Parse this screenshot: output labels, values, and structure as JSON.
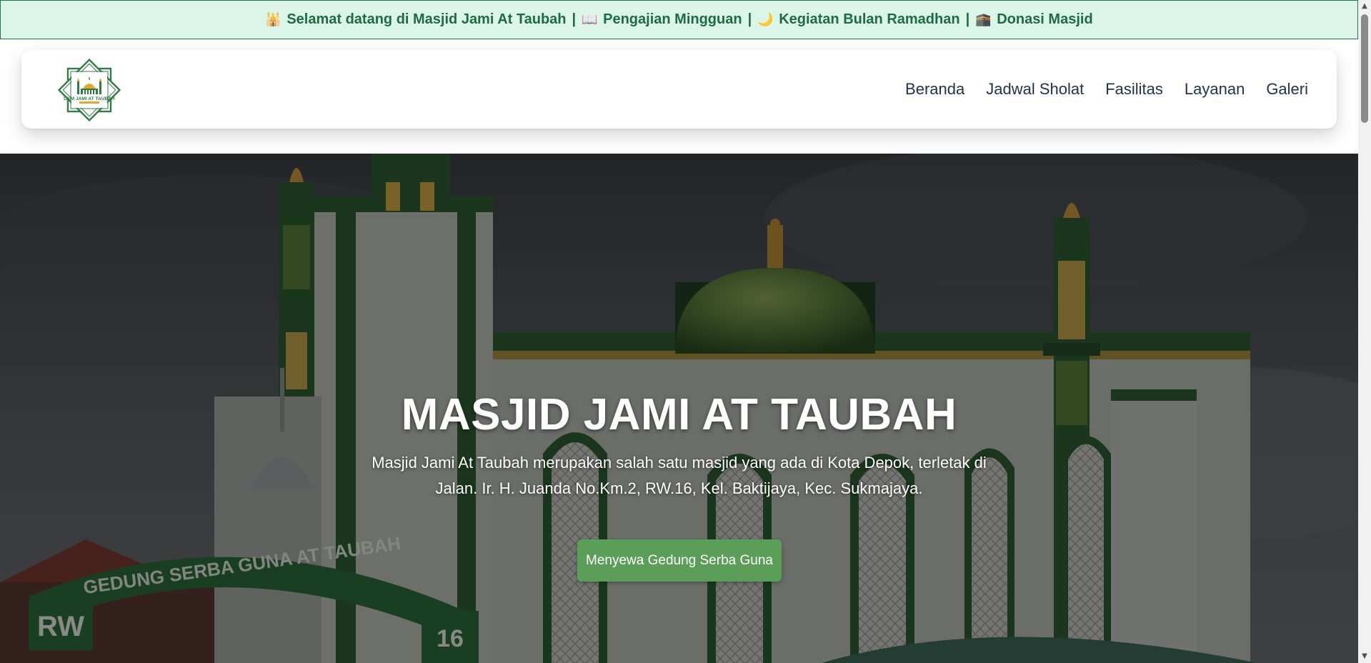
{
  "announcement": {
    "items": [
      {
        "icon": "mosque-icon",
        "glyph": "🕌",
        "text": "Selamat datang di Masjid Jami At Taubah"
      },
      {
        "icon": "open-book-icon",
        "glyph": "📖",
        "text": "Pengajian Mingguan"
      },
      {
        "icon": "crescent-moon-icon",
        "glyph": "🌙",
        "text": "Kegiatan Bulan Ramadhan"
      },
      {
        "icon": "kaaba-icon",
        "glyph": "🕋",
        "text": "Donasi Masjid"
      }
    ],
    "separator": "|"
  },
  "header": {
    "logo_text": "DKM JAMI AT TAUBAH",
    "nav": [
      {
        "label": "Beranda"
      },
      {
        "label": "Jadwal Sholat"
      },
      {
        "label": "Fasilitas"
      },
      {
        "label": "Layanan"
      },
      {
        "label": "Galeri"
      }
    ]
  },
  "hero": {
    "title": "MASJID JAMI AT TAUBAH",
    "description": "Masjid Jami At Taubah merupakan salah satu masjid yang ada di Kota Depok, terletak di Jalan. Ir. H. Juanda No.Km.2, RW.16, Kel. Baktijaya, Kec. Sukmajaya.",
    "button_label": "Menyewa Gedung Serba Guna",
    "image_text": {
      "arch": "GEDUNG SERBA GUNA AT TAUBAH",
      "rw_sign": "RW",
      "number_sign": "16"
    }
  },
  "colors": {
    "announce_bg": "#dcf5e9",
    "announce_text": "#1c6b43",
    "nav_text": "#22344a",
    "button_bg": "#5a9e57",
    "mosque_green": "#2f6b3e"
  }
}
